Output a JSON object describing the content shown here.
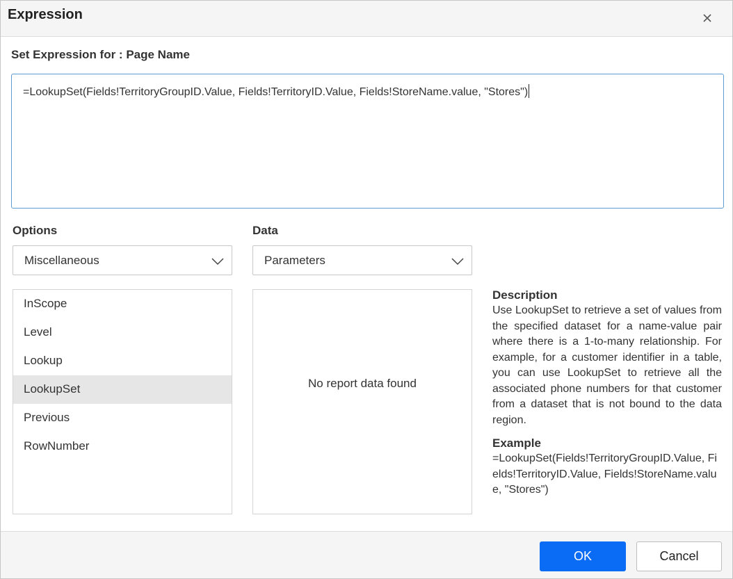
{
  "dialog": {
    "title": "Expression",
    "close_icon": "close-icon"
  },
  "expression": {
    "label": "Set Expression for : Page Name",
    "value": "=LookupSet(Fields!TerritoryGroupID.Value, Fields!TerritoryID.Value, Fields!StoreName.value, \"Stores\")"
  },
  "options": {
    "label": "Options",
    "selected": "Miscellaneous",
    "items": [
      "InScope",
      "Level",
      "Lookup",
      "LookupSet",
      "Previous",
      "RowNumber"
    ],
    "selected_item": "LookupSet"
  },
  "data": {
    "label": "Data",
    "selected": "Parameters",
    "empty_message": "No report data found"
  },
  "description": {
    "heading": "Description",
    "text": "Use LookupSet to retrieve a set of values from the specified dataset for a name-value pair where there is a 1-to-many relationship. For example, for a customer identifier in a table, you can use LookupSet to retrieve all the associated phone numbers for that customer from a dataset that is not bound to the data region.",
    "example_heading": "Example",
    "example_text": "=LookupSet(Fields!TerritoryGroupID.Value, Fields!TerritoryID.Value, Fields!StoreName.value, \"Stores\")"
  },
  "footer": {
    "ok_label": "OK",
    "cancel_label": "Cancel"
  },
  "colors": {
    "accent": "#0a6cf5",
    "focus_border": "#5b9bd5",
    "selected_row": "#e6e6e6",
    "header_bg": "#f5f5f5"
  }
}
